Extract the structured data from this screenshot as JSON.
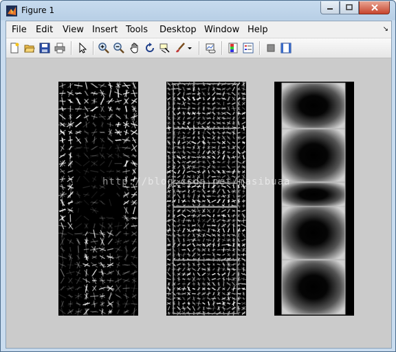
{
  "window": {
    "title": "Figure 1"
  },
  "menu": {
    "items": [
      "File",
      "Edit",
      "View",
      "Insert",
      "Tools",
      "Desktop",
      "Window",
      "Help"
    ]
  },
  "watermark": "http://blog.csdn.net/masibuaa",
  "colors": {
    "canvas": "#cbcbcb",
    "titlebar": "#b9d1ea"
  },
  "toolbar": {
    "icons": [
      "new-figure-icon",
      "open-file-icon",
      "save-icon",
      "print-icon",
      "pointer-icon",
      "zoom-in-icon",
      "zoom-out-icon",
      "pan-icon",
      "rotate-3d-icon",
      "data-cursor-icon",
      "brush-icon",
      "brush-dropdown-icon",
      "link-plot-icon",
      "insert-colorbar-icon",
      "insert-legend-icon",
      "hide-plot-tools-icon",
      "show-plot-tools-icon"
    ]
  }
}
